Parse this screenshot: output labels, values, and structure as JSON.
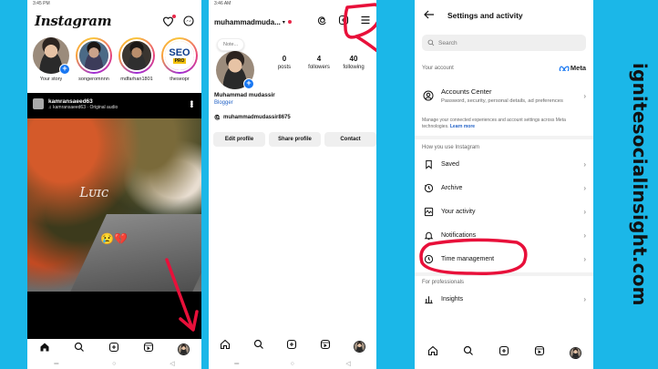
{
  "phone1": {
    "status_time": "3:45 PM",
    "logo": "Instagram",
    "stories": [
      {
        "name": "Your story",
        "style": "plain",
        "face": "a",
        "badge": "+"
      },
      {
        "name": "songeromnnn",
        "style": "ring",
        "face": "b"
      },
      {
        "name": "mdfarhan1801",
        "style": "ring",
        "face": "c"
      },
      {
        "name": "theseopr",
        "style": "ring",
        "face": "seo",
        "seo_text": "SEO",
        "seo_sub": "PRO"
      }
    ],
    "reel": {
      "user": "kamransaeed63",
      "audio": "kamransaeed63 · Original audio",
      "overlay_text": "Lᴜɪᴄ",
      "emoji": "😢💔"
    }
  },
  "phone2": {
    "status_time": "3:46 AM",
    "username": "muhammadmuda...",
    "note": "Note...",
    "stats": [
      {
        "num": "0",
        "label": "posts"
      },
      {
        "num": "4",
        "label": "followers"
      },
      {
        "num": "40",
        "label": "following"
      }
    ],
    "name": "Muhammad mudassir",
    "category": "Blogger",
    "threads_handle": "muhammadmudassir8675",
    "buttons": [
      "Edit profile",
      "Share profile",
      "Contact"
    ]
  },
  "phone3": {
    "title": "Settings and activity",
    "search_placeholder": "Search",
    "your_account_label": "Your account",
    "meta_label": "Meta",
    "accounts_center": {
      "title": "Accounts Center",
      "desc": "Password, security, personal details, ad preferences"
    },
    "manage_note": "Manage your connected experiences and account settings across Meta technologies.",
    "learn_more": "Learn more",
    "how_you_use_label": "How you use Instagram",
    "items": [
      {
        "label": "Saved",
        "icon": "bookmark-icon"
      },
      {
        "label": "Archive",
        "icon": "archive-icon"
      },
      {
        "label": "Your activity",
        "icon": "activity-icon"
      },
      {
        "label": "Notifications",
        "icon": "bell-icon"
      },
      {
        "label": "Time management",
        "icon": "clock-icon"
      }
    ],
    "for_professionals_label": "For professionals",
    "insights": "Insights"
  },
  "watermark": "ignitesocialinsight.com",
  "colors": {
    "background": "#1bb7e8",
    "annotation": "#e8103a",
    "link": "#2463c7",
    "badge": "#1877f2"
  }
}
